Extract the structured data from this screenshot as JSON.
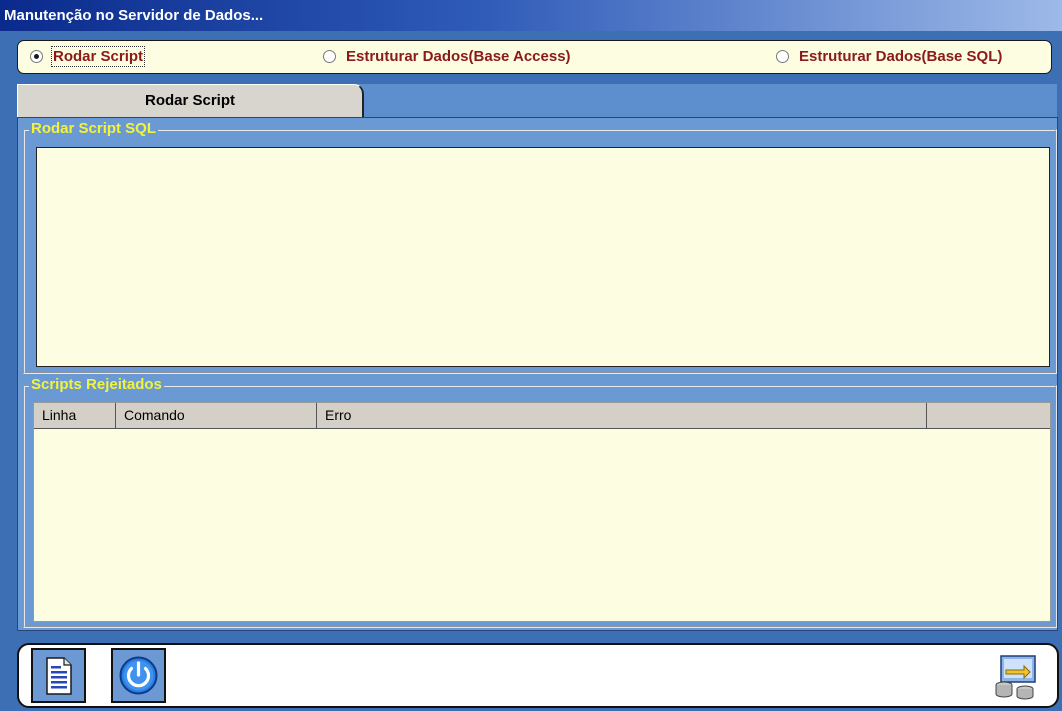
{
  "window": {
    "title": "Manutenção no Servidor de Dados..."
  },
  "options": [
    {
      "label": "Rodar Script",
      "checked": true
    },
    {
      "label": "Estruturar Dados(Base Access)",
      "checked": false
    },
    {
      "label": "Estruturar Dados(Base SQL)",
      "checked": false
    }
  ],
  "tabs": [
    {
      "label": "Rodar Script"
    }
  ],
  "groups": {
    "script": {
      "label": "Rodar Script SQL"
    },
    "rejected": {
      "label": "Scripts Rejeitados"
    }
  },
  "grid": {
    "columns": [
      "Linha",
      "Comando",
      "Erro",
      ""
    ]
  },
  "toolbar": {
    "buttons": [
      {
        "icon": "document-icon"
      },
      {
        "icon": "power-icon"
      },
      {
        "icon": "database-transfer-icon"
      }
    ]
  },
  "colors": {
    "background": "#3d6fb5",
    "panel": "#6b99d4",
    "field": "#fdfde2",
    "option_text": "#8b1a1a",
    "legend_text": "#f3f33a"
  }
}
